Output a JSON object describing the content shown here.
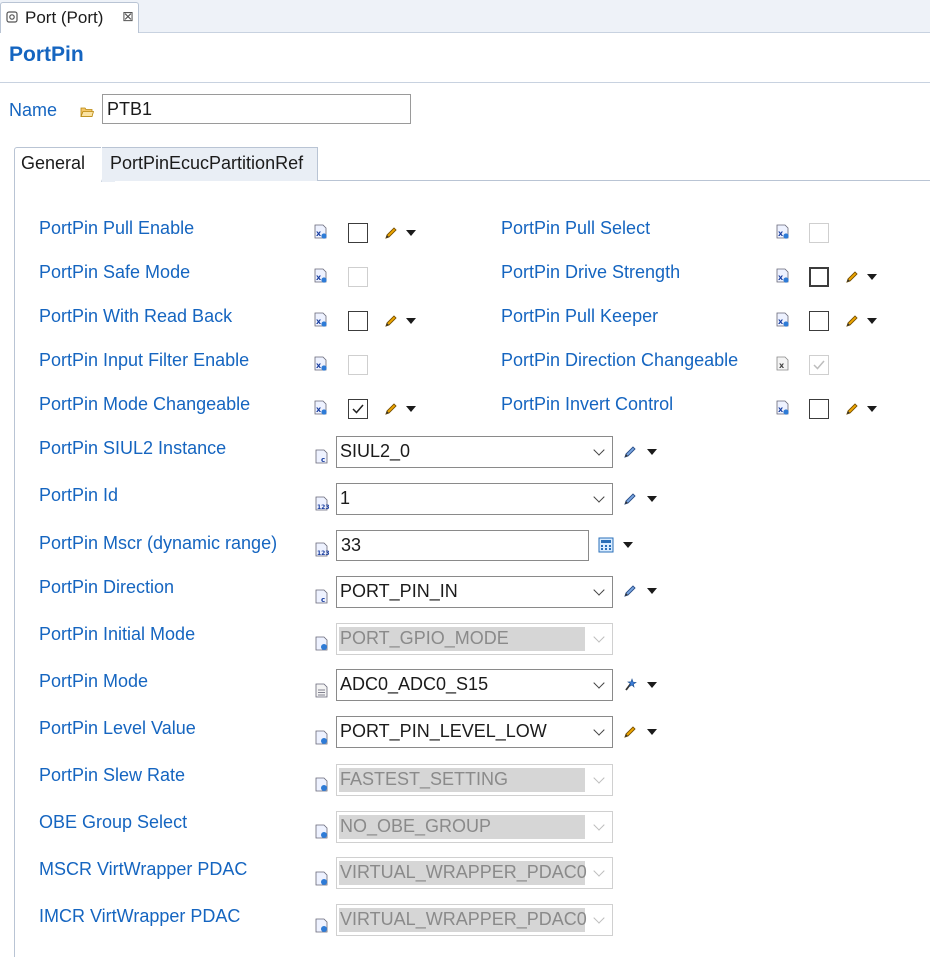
{
  "editor_tab": {
    "label": "Port (Port)",
    "icon": "port-icon",
    "close_glyph": "⊠"
  },
  "form": {
    "title": "PortPin"
  },
  "name_field": {
    "label": "Name",
    "value": "PTB1",
    "icon": "folder-icon"
  },
  "section_tabs": [
    {
      "label": "General",
      "selected": true
    },
    {
      "label": "PortPinEcucPartitionRef",
      "selected": false
    }
  ],
  "checkbox_params_left": [
    {
      "label": "PortPin Pull Enable",
      "checked": false,
      "enabled": true
    },
    {
      "label": "PortPin Safe Mode",
      "checked": false,
      "enabled": false
    },
    {
      "label": "PortPin With Read Back",
      "checked": false,
      "enabled": true
    },
    {
      "label": "PortPin Input Filter Enable",
      "checked": false,
      "enabled": false
    },
    {
      "label": "PortPin Mode Changeable",
      "checked": true,
      "enabled": true
    }
  ],
  "checkbox_params_right": [
    {
      "label": "PortPin Pull Select",
      "checked": false,
      "enabled": false
    },
    {
      "label": "PortPin Drive Strength",
      "checked": false,
      "enabled": true
    },
    {
      "label": "PortPin Pull Keeper",
      "checked": false,
      "enabled": true
    },
    {
      "label": "PortPin Direction Changeable",
      "checked": true,
      "enabled": false
    },
    {
      "label": "PortPin Invert Control",
      "checked": false,
      "enabled": true
    }
  ],
  "field_params": [
    {
      "label": "PortPin SIUL2 Instance",
      "value": "SIUL2_0",
      "enabled": true,
      "kind": "combo"
    },
    {
      "label": "PortPin Id",
      "value": "1",
      "enabled": true,
      "kind": "combo"
    },
    {
      "label": "PortPin Mscr (dynamic range)",
      "value": "33",
      "enabled": true,
      "kind": "text"
    },
    {
      "label": "PortPin Direction",
      "value": "PORT_PIN_IN",
      "enabled": true,
      "kind": "combo"
    },
    {
      "label": "PortPin Initial Mode",
      "value": "PORT_GPIO_MODE",
      "enabled": false,
      "kind": "combo"
    },
    {
      "label": "PortPin Mode",
      "value": "ADC0_ADC0_S15",
      "enabled": true,
      "kind": "combo"
    },
    {
      "label": "PortPin Level Value",
      "value": "PORT_PIN_LEVEL_LOW",
      "enabled": true,
      "kind": "combo"
    },
    {
      "label": "PortPin Slew Rate",
      "value": "FASTEST_SETTING",
      "enabled": false,
      "kind": "combo"
    },
    {
      "label": "OBE Group Select",
      "value": "NO_OBE_GROUP",
      "enabled": false,
      "kind": "combo"
    },
    {
      "label": "MSCR VirtWrapper PDAC",
      "value": "VIRTUAL_WRAPPER_PDAC0",
      "enabled": false,
      "kind": "combo"
    },
    {
      "label": "IMCR VirtWrapper PDAC",
      "value": "VIRTUAL_WRAPPER_PDAC0",
      "enabled": false,
      "kind": "combo"
    }
  ],
  "colors": {
    "label_blue": "#1565c0",
    "disabled_fill": "#d6d6d6"
  }
}
